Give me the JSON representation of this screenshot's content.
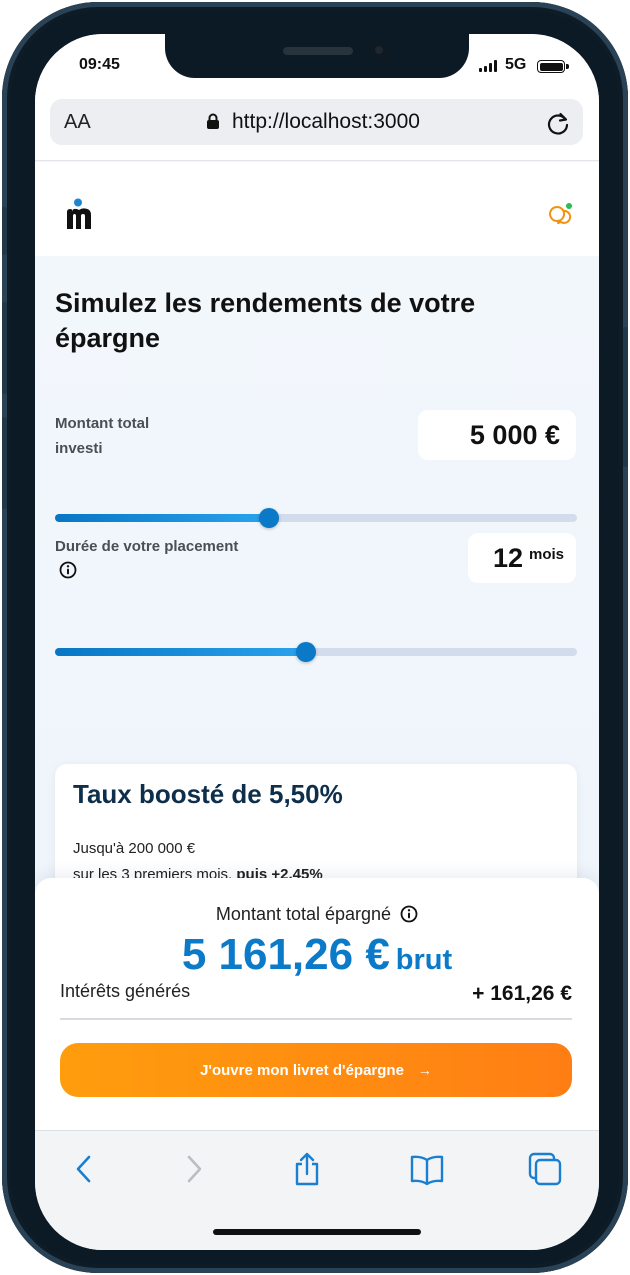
{
  "status_bar": {
    "time": "09:45",
    "network": "5G"
  },
  "browser": {
    "text_size_label": "AA",
    "url": "http://localhost:3000"
  },
  "header": {
    "logo_icon": "m-logo",
    "chat_icon": "chat-icon"
  },
  "simulator": {
    "title": "Simulez les rendements de votre épargne",
    "amount": {
      "label": "Montant total investi",
      "value": "5 000 €",
      "slider_fraction": 0.41
    },
    "duration": {
      "label": "Durée de votre placement",
      "value": "12",
      "unit": "mois",
      "slider_fraction": 0.48
    }
  },
  "rate_card": {
    "title": "Taux boosté de 5,50%",
    "line1": "Jusqu'à 200 000 €",
    "line2_prefix": "sur les 3 premiers mois,",
    "line2_bold": "puis +2,45%"
  },
  "summary": {
    "label": "Montant total épargné",
    "total": "5 161,26 €",
    "total_suffix": "brut",
    "interest_label": "Intérêts générés",
    "interest_value": "+ 161,26 €",
    "cta_label": "J'ouvre mon livret d'épargne",
    "cta_arrow": "→"
  },
  "colors": {
    "accent_blue": "#0b7ac9",
    "cta_orange": "#ff8c10",
    "title_navy": "#0e2f4c"
  }
}
